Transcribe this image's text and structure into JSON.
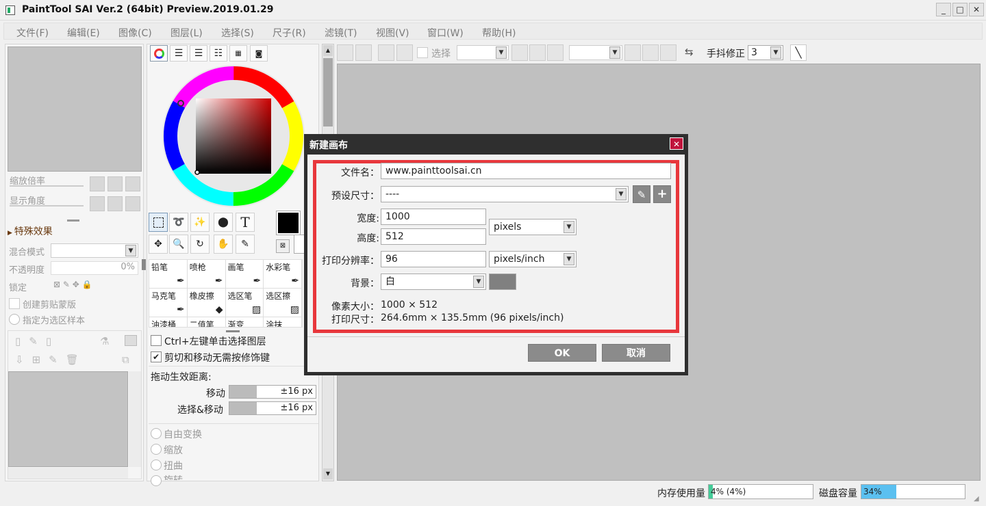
{
  "window": {
    "title": "PaintTool SAI Ver.2 (64bit) Preview.2019.01.29",
    "minimize": "_",
    "maximize": "□",
    "close": "✕"
  },
  "menu": [
    "文件(F)",
    "编辑(E)",
    "图像(C)",
    "图层(L)",
    "选择(S)",
    "尺子(R)",
    "滤镜(T)",
    "视图(V)",
    "窗口(W)",
    "帮助(H)"
  ],
  "navigator": {
    "zoom_label": "缩放倍率",
    "angle_label": "显示角度"
  },
  "layer_panel": {
    "effects_label": "特殊效果",
    "blend_label": "混合模式",
    "opacity_label": "不透明度",
    "opacity_value": "0%",
    "lock_label": "锁定",
    "clip_label": "创建剪贴蒙版",
    "sample_label": "指定为选区样本"
  },
  "color": {
    "current": "#000000"
  },
  "tools": {
    "text_tool": "T"
  },
  "brushes": [
    [
      "铅笔",
      "喷枪",
      "画笔",
      "水彩笔"
    ],
    [
      "马克笔",
      "橡皮擦",
      "选区笔",
      "选区擦"
    ],
    [
      "油漆桶",
      "二值笔",
      "渐变",
      "涂抹"
    ]
  ],
  "options": {
    "ctrl_click": "Ctrl+左键单击选择图层",
    "cut_move": "剪切和移动无需按修饰键",
    "drag_label": "拖动生效距离:",
    "move_label": "移动",
    "move_value": "±16 px",
    "selmove_label": "选择&移动",
    "selmove_value": "±16 px",
    "free_transform": "自由变换",
    "scale": "缩放",
    "distort": "扭曲",
    "rotate": "旋转"
  },
  "toolbar": {
    "select_label": "选择",
    "stabilizer_label": "手抖修正",
    "stabilizer_value": "3"
  },
  "dialog": {
    "title": "新建画布",
    "filename_label": "文件名：",
    "filename_value": "www.painttoolsai.cn",
    "preset_label": "预设尺寸：",
    "preset_value": "----",
    "width_label": "宽度:",
    "width_value": "1000",
    "height_label": "高度:",
    "height_value": "512",
    "unit_value": "pixels",
    "dpi_label": "打印分辨率：",
    "dpi_value": "96",
    "dpi_unit": "pixels/inch",
    "bg_label": "背景：",
    "bg_value": "白",
    "pixel_size_label": "像素大小：",
    "pixel_size_value": "1000 × 512",
    "print_size_label": "打印尺寸：",
    "print_size_value": "264.6mm × 135.5mm (96 pixels/inch)",
    "ok": "OK",
    "cancel": "取消"
  },
  "status": {
    "mem_label": "内存使用量",
    "mem_value": "4% (4%)",
    "mem_fraction": 0.04,
    "disk_label": "磁盘容量",
    "disk_value": "34%",
    "disk_fraction": 0.34
  }
}
